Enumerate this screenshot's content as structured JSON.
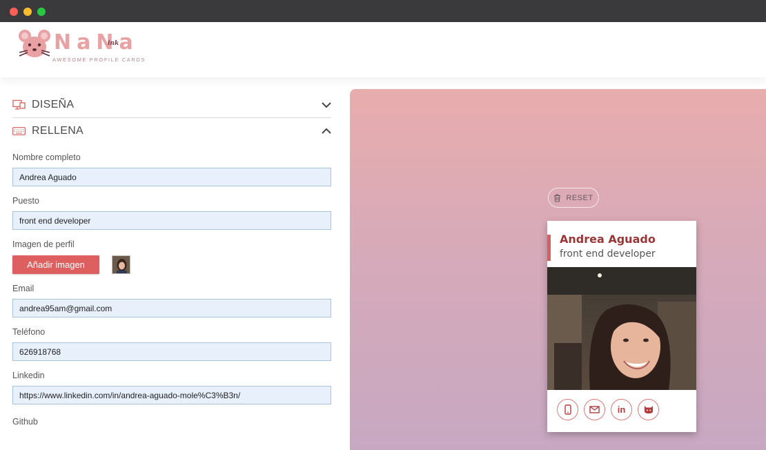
{
  "window": {
    "controls": [
      "close",
      "minimize",
      "maximize"
    ]
  },
  "header": {
    "logo_word": "NaNa",
    "logo_suffix": "ink",
    "logo_tagline": "AWESOME PROFILE CARDS",
    "logo_icon": "mouse-face-icon"
  },
  "sections": {
    "design": {
      "title": "DISEÑA",
      "icon": "design-icon",
      "expanded": false
    },
    "fill": {
      "title": "RELLENA",
      "icon": "keyboard-icon",
      "expanded": true
    }
  },
  "form": {
    "name_label": "Nombre completo",
    "name_value": "Andrea Aguado",
    "job_label": "Puesto",
    "job_value": "front end developer",
    "image_label": "Imagen de perfil",
    "add_image_button": "Añadir imagen",
    "email_label": "Email",
    "email_value": "andrea95am@gmail.com",
    "phone_label": "Teléfono",
    "phone_value": "626918768",
    "linkedin_label": "Linkedin",
    "linkedin_value": "https://www.linkedin.com/in/andrea-aguado-mole%C3%B3n/",
    "github_label": "Github"
  },
  "preview": {
    "reset_label": "RESET",
    "card_name": "Andrea Aguado",
    "card_job": "front end developer",
    "socials": [
      "phone-icon",
      "mail-icon",
      "linkedin-icon",
      "github-icon"
    ],
    "linkedin_glyph": "in"
  },
  "colors": {
    "accent": "#de5f5f",
    "card_name": "#9b3636",
    "preview_top": "#e8adad",
    "preview_bottom": "#c7a8c2"
  }
}
